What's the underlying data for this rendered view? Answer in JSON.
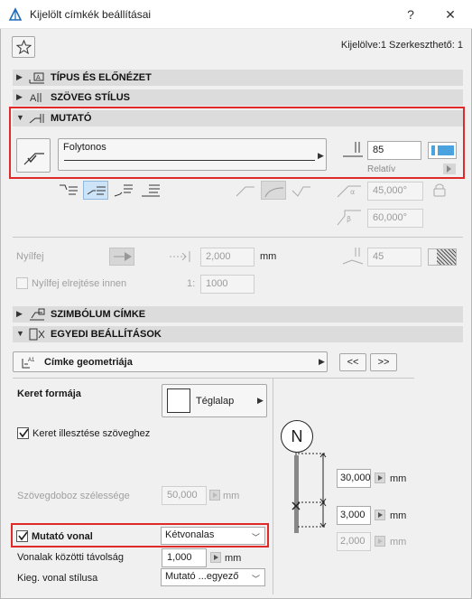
{
  "window": {
    "title": "Kijelölt címkék beállításai",
    "help_label": "?",
    "close_label": "✕"
  },
  "header": {
    "selection_info": "Kijelölve:1 Szerkeszthető: 1"
  },
  "sections": {
    "type_preview": "TÍPUS ÉS ELŐNÉZET",
    "text_style": "SZÖVEG STÍLUS",
    "pointer": "MUTATÓ",
    "symbol_label": "SZIMBÓLUM CÍMKE",
    "custom_settings": "EGYEDI BEÁLLÍTÁSOK"
  },
  "pointer": {
    "line_type": "Folytonos",
    "pen_value": "85",
    "relative_label": "Relatív",
    "angle1": "45,000°",
    "angle2": "60,000°",
    "arrowhead_label": "Nyílfej",
    "arrowhead_size": "2,000",
    "arrowhead_unit": "mm",
    "arrowhead_pen": "45",
    "hide_arrow_label": "Nyílfej elrejtése innen",
    "scale_prefix": "1:",
    "scale_value": "1000"
  },
  "custom": {
    "geometry_label": "Címke geometriája",
    "prev_label": "<<",
    "next_label": ">>",
    "frame_shape_label": "Keret formája",
    "frame_shape_value": "Téglalap",
    "fit_frame_label": "Keret illesztése szöveghez",
    "textbox_width_label": "Szövegdoboz szélessége",
    "textbox_width_value": "50,000",
    "textbox_width_unit": "mm",
    "pointer_line_label": "Mutató vonal",
    "pointer_line_value": "Kétvonalas",
    "line_distance_label": "Vonalak közötti távolság",
    "line_distance_value": "1,000",
    "line_distance_unit": "mm",
    "ext_line_style_label": "Kieg. vonal stílusa",
    "ext_line_style_value": "Mutató ...egyező",
    "preview_marker": "N",
    "dim1_value": "30,000",
    "dim1_unit": "mm",
    "dim2_value": "3,000",
    "dim2_unit": "mm",
    "dim3_value": "2,000",
    "dim3_unit": "mm"
  }
}
